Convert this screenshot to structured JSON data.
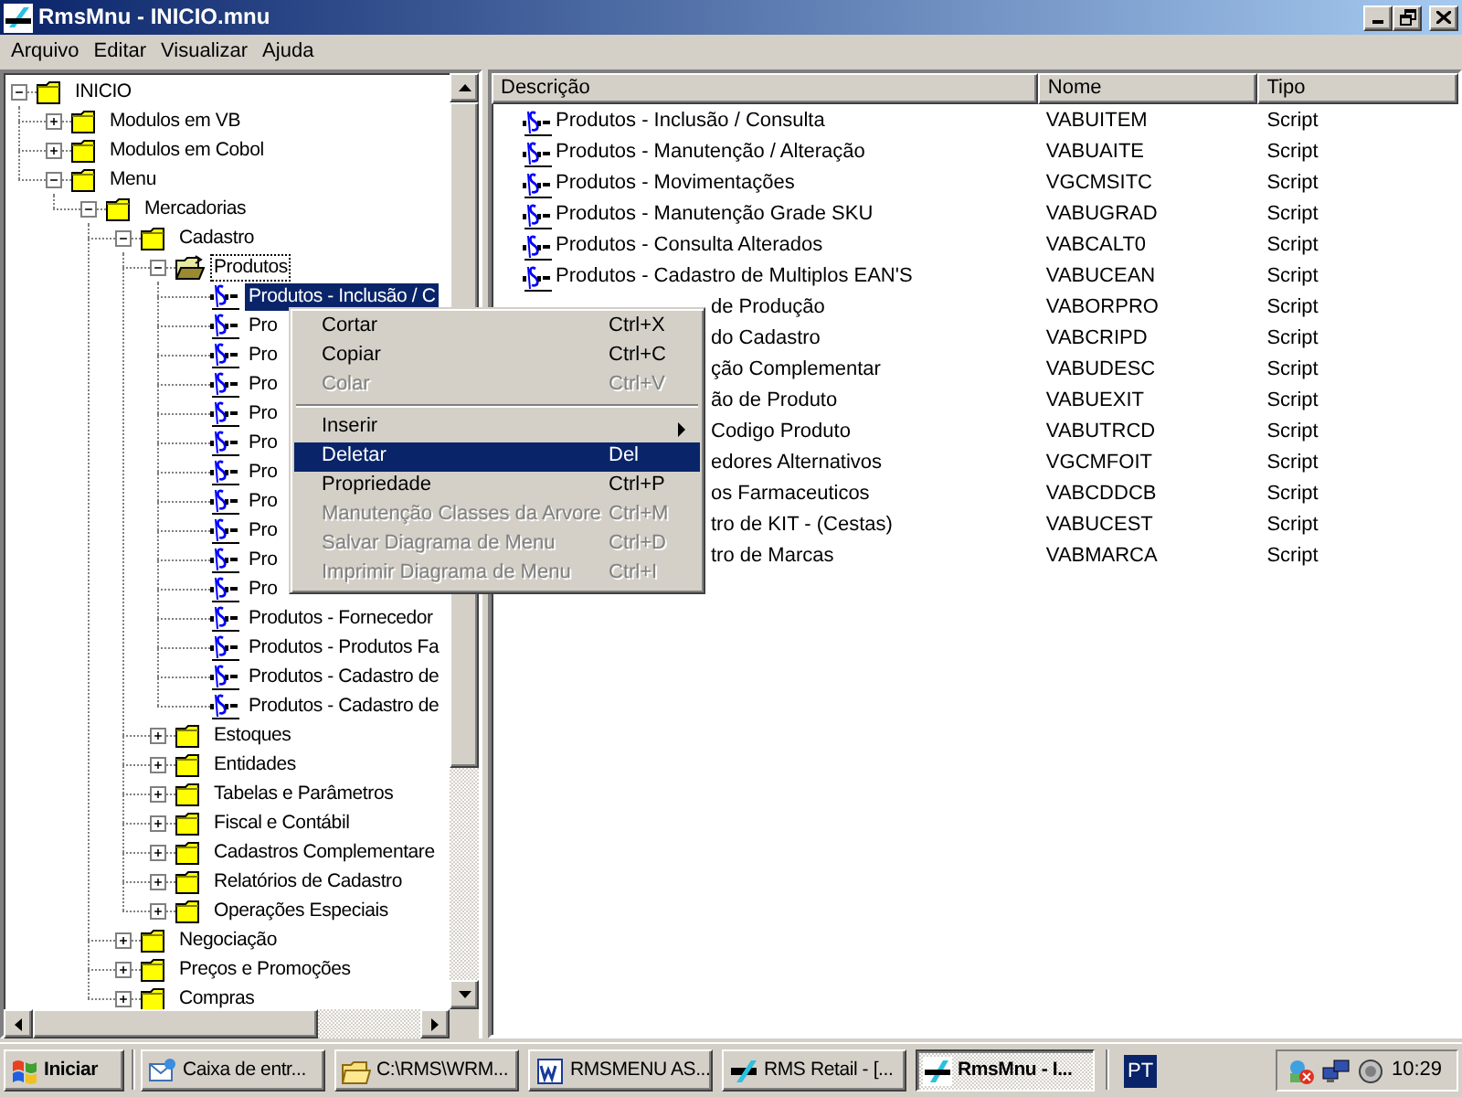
{
  "window": {
    "title": "RmsMnu - INICIO.mnu"
  },
  "menu_bar": [
    "Arquivo",
    "Editar",
    "Visualizar",
    "Ajuda"
  ],
  "tree": [
    {
      "kind": "folder",
      "label": "INICIO",
      "expanded": true,
      "selected": false,
      "focused": false,
      "children": [
        {
          "kind": "folder",
          "label": "Modulos em VB",
          "expanded": false,
          "selected": false,
          "focused": false
        },
        {
          "kind": "folder",
          "label": "Modulos em Cobol",
          "expanded": false,
          "selected": false,
          "focused": false
        },
        {
          "kind": "folder",
          "label": "Menu",
          "expanded": true,
          "selected": false,
          "focused": false,
          "children": [
            {
              "kind": "folder",
              "label": "Mercadorias",
              "expanded": true,
              "selected": false,
              "focused": false,
              "children": [
                {
                  "kind": "folder",
                  "label": "Cadastro",
                  "expanded": true,
                  "selected": false,
                  "focused": false,
                  "children": [
                    {
                      "kind": "folder",
                      "label": "Produtos",
                      "expanded": true,
                      "selected": false,
                      "focused": true,
                      "children": [
                        {
                          "kind": "script",
                          "label": "Produtos - Inclusão / C",
                          "selected": true,
                          "focused": false
                        },
                        {
                          "kind": "script",
                          "label": "Pro",
                          "selected": false,
                          "focused": false
                        },
                        {
                          "kind": "script",
                          "label": "Pro",
                          "selected": false,
                          "focused": false
                        },
                        {
                          "kind": "script",
                          "label": "Pro",
                          "selected": false,
                          "focused": false
                        },
                        {
                          "kind": "script",
                          "label": "Pro",
                          "selected": false,
                          "focused": false
                        },
                        {
                          "kind": "script",
                          "label": "Pro",
                          "selected": false,
                          "focused": false
                        },
                        {
                          "kind": "script",
                          "label": "Pro",
                          "selected": false,
                          "focused": false
                        },
                        {
                          "kind": "script",
                          "label": "Pro",
                          "selected": false,
                          "focused": false
                        },
                        {
                          "kind": "script",
                          "label": "Pro",
                          "selected": false,
                          "focused": false
                        },
                        {
                          "kind": "script",
                          "label": "Pro",
                          "selected": false,
                          "focused": false
                        },
                        {
                          "kind": "script",
                          "label": "Pro",
                          "selected": false,
                          "focused": false
                        },
                        {
                          "kind": "script",
                          "label": "Produtos - Fornecedor",
                          "selected": false,
                          "focused": false
                        },
                        {
                          "kind": "script",
                          "label": "Produtos - Produtos Fa",
                          "selected": false,
                          "focused": false
                        },
                        {
                          "kind": "script",
                          "label": "Produtos - Cadastro de",
                          "selected": false,
                          "focused": false
                        },
                        {
                          "kind": "script",
                          "label": "Produtos - Cadastro de",
                          "selected": false,
                          "focused": false
                        }
                      ]
                    },
                    {
                      "kind": "folder",
                      "label": "Estoques",
                      "expanded": false,
                      "selected": false,
                      "focused": false
                    },
                    {
                      "kind": "folder",
                      "label": "Entidades",
                      "expanded": false,
                      "selected": false,
                      "focused": false
                    },
                    {
                      "kind": "folder",
                      "label": "Tabelas e Parâmetros",
                      "expanded": false,
                      "selected": false,
                      "focused": false
                    },
                    {
                      "kind": "folder",
                      "label": "Fiscal e Contábil",
                      "expanded": false,
                      "selected": false,
                      "focused": false
                    },
                    {
                      "kind": "folder",
                      "label": "Cadastros Complementare",
                      "expanded": false,
                      "selected": false,
                      "focused": false
                    },
                    {
                      "kind": "folder",
                      "label": "Relatórios de Cadastro",
                      "expanded": false,
                      "selected": false,
                      "focused": false
                    },
                    {
                      "kind": "folder",
                      "label": "Operações Especiais",
                      "expanded": false,
                      "selected": false,
                      "focused": false
                    }
                  ]
                },
                {
                  "kind": "folder",
                  "label": "Negociação",
                  "expanded": false,
                  "selected": false,
                  "focused": false
                },
                {
                  "kind": "folder",
                  "label": "Preços e Promoções",
                  "expanded": false,
                  "selected": false,
                  "focused": false
                },
                {
                  "kind": "folder",
                  "label": "Compras",
                  "expanded": false,
                  "selected": false,
                  "focused": false
                }
              ]
            }
          ]
        }
      ]
    }
  ],
  "list": {
    "columns": [
      "Descrição",
      "Nome",
      "Tipo"
    ],
    "rows": [
      {
        "kind": "full",
        "description": "Produtos - Inclusão / Consulta",
        "name": "VABUITEM",
        "type": "Script"
      },
      {
        "kind": "full",
        "description": "Produtos - Manutenção / Alteração",
        "name": "VABUAITE",
        "type": "Script"
      },
      {
        "kind": "full",
        "description": "Produtos - Movimentações",
        "name": "VGCMSITC",
        "type": "Script"
      },
      {
        "kind": "full",
        "description": "Produtos - Manutenção Grade SKU",
        "name": "VABUGRAD",
        "type": "Script"
      },
      {
        "kind": "full",
        "description": "Produtos - Consulta Alterados",
        "name": "VABCALT0",
        "type": "Script"
      },
      {
        "kind": "full",
        "description": "Produtos - Cadastro de Multiplos EAN'S",
        "name": "VABUCEAN",
        "type": "Script"
      },
      {
        "kind": "covered",
        "description": "de Produção",
        "name": "VABORPRO",
        "type": "Script"
      },
      {
        "kind": "covered",
        "description": "do Cadastro",
        "name": "VABCRIPD",
        "type": "Script"
      },
      {
        "kind": "covered",
        "description": "ção Complementar",
        "name": "VABUDESC",
        "type": "Script"
      },
      {
        "kind": "covered",
        "description": "ão de Produto",
        "name": "VABUEXIT",
        "type": "Script"
      },
      {
        "kind": "covered",
        "description": "Codigo Produto",
        "name": "VABUTRCD",
        "type": "Script"
      },
      {
        "kind": "covered",
        "description": "edores Alternativos",
        "name": "VGCMFOIT",
        "type": "Script"
      },
      {
        "kind": "covered",
        "description": "os Farmaceuticos",
        "name": "VABCDDCB",
        "type": "Script"
      },
      {
        "kind": "covered",
        "description": "tro de KIT - (Cestas)",
        "name": "VABUCEST",
        "type": "Script"
      },
      {
        "kind": "covered",
        "description": "tro de Marcas",
        "name": "VABMARCA",
        "type": "Script"
      }
    ]
  },
  "context_menu": [
    {
      "kind": "item",
      "label": "Cortar",
      "shortcut": "Ctrl+X",
      "disabled": false,
      "selected": false,
      "submenu": false
    },
    {
      "kind": "item",
      "label": "Copiar",
      "shortcut": "Ctrl+C",
      "disabled": false,
      "selected": false,
      "submenu": false
    },
    {
      "kind": "item",
      "label": "Colar",
      "shortcut": "Ctrl+V",
      "disabled": true,
      "selected": false,
      "submenu": false
    },
    {
      "kind": "separator"
    },
    {
      "kind": "item",
      "label": "Inserir",
      "disabled": false,
      "selected": false,
      "submenu": true
    },
    {
      "kind": "item",
      "label": "Deletar",
      "shortcut": "Del",
      "disabled": false,
      "selected": true,
      "submenu": false
    },
    {
      "kind": "item",
      "label": "Propriedade",
      "shortcut": "Ctrl+P",
      "disabled": false,
      "selected": false,
      "submenu": false
    },
    {
      "kind": "item",
      "label": "Manutenção Classes da Arvore",
      "shortcut": "Ctrl+M",
      "disabled": true,
      "selected": false,
      "submenu": false
    },
    {
      "kind": "item",
      "label": "Salvar Diagrama de Menu",
      "shortcut": "Ctrl+D",
      "disabled": true,
      "selected": false,
      "submenu": false
    },
    {
      "kind": "item",
      "label": "Imprimir Diagrama de Menu",
      "shortcut": "Ctrl+I",
      "disabled": true,
      "selected": false,
      "submenu": false
    }
  ],
  "taskbar": {
    "start": "Iniciar",
    "tasks": [
      {
        "kind": "mail",
        "label": "Caixa de entr...",
        "selected": false
      },
      {
        "kind": "folder",
        "label": "C:\\RMS\\WRM...",
        "selected": false
      },
      {
        "kind": "document",
        "label": "RMSMENU AS...",
        "selected": false
      },
      {
        "kind": "retail",
        "label": "RMS Retail - [...",
        "selected": false
      },
      {
        "kind": "app",
        "label": "RmsMnu - I...",
        "selected": true
      }
    ],
    "language": "PT",
    "clock": "10:29"
  }
}
